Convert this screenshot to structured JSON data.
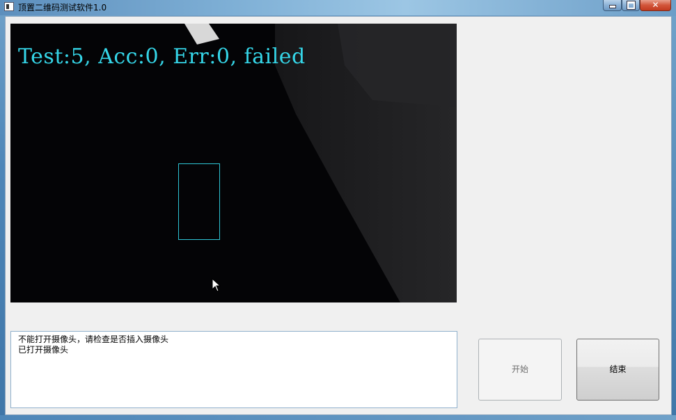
{
  "window": {
    "title": "顶置二维码测试软件1.0",
    "close_glyph": "✕"
  },
  "video": {
    "overlay_text": "Test:5, Acc:0, Err:0, failed",
    "overlay_color": "#35d6e8",
    "box_color": "#2ec6d6"
  },
  "log": {
    "lines": [
      "不能打开摄像头，请检查是否插入摄像头",
      "已打开摄像头"
    ]
  },
  "buttons": {
    "start_label": "开始",
    "end_label": "结束"
  }
}
